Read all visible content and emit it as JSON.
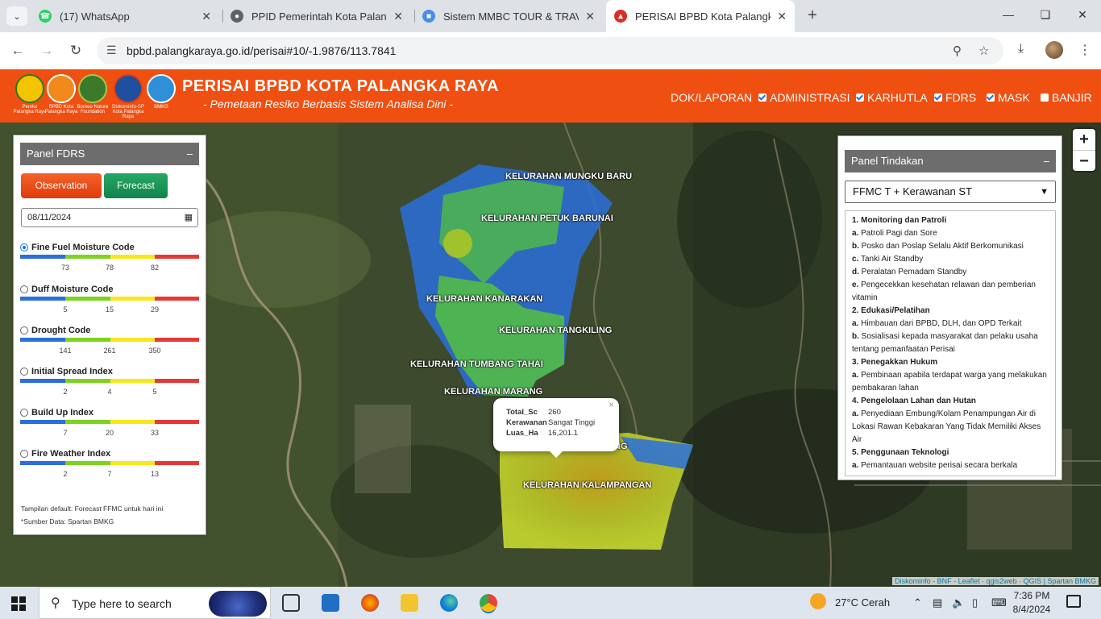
{
  "browser": {
    "tabs": [
      {
        "title": "(17) WhatsApp",
        "icon": "whatsapp-icon",
        "color": "#25d366"
      },
      {
        "title": "PPID Pemerintah Kota Palangka",
        "icon": "globe-icon",
        "color": "#5f6368"
      },
      {
        "title": "Sistem MMBC TOUR & TRAVEL",
        "icon": "site-icon",
        "color": "#4a8fe7"
      },
      {
        "title": "PERISAI BPBD Kota Palangka Ra",
        "icon": "bpbd-icon",
        "color": "#d93025"
      }
    ],
    "url": "bpbd.palangkaraya.go.id/perisai#10/-1.9876/113.7841"
  },
  "header": {
    "title": "PERISAI BPBD KOTA PALANGKA RAYA",
    "subtitle": "- Pemetaan Resiko Berbasis Sistem Analisa Dini -",
    "logos": [
      {
        "caption": "Pemko Palangka Raya",
        "color": "#f5c400"
      },
      {
        "caption": "BPBD Kota Palangka Raya",
        "color": "#f28a1b"
      },
      {
        "caption": "Borneo Nature Foundation",
        "color": "#3a7a2a"
      },
      {
        "caption": "Diskominfo-SP Kota Palangka Raya",
        "color": "#1f4f9e"
      },
      {
        "caption": "BMKG",
        "color": "#2f8fd8"
      }
    ],
    "nav": [
      {
        "label": "DOK/LAPORAN",
        "checkbox": false
      },
      {
        "label": "ADMINISTRASI",
        "checkbox": true,
        "checked": true
      },
      {
        "label": "KARHUTLA",
        "checkbox": true,
        "checked": true
      },
      {
        "label": "FDRS",
        "checkbox": true,
        "checked": true
      },
      {
        "label": "MASK",
        "checkbox": true,
        "checked": true
      },
      {
        "label": "BANJIR",
        "checkbox": true,
        "checked": false
      }
    ]
  },
  "fdrs": {
    "title": "Panel FDRS",
    "minimize": "–",
    "observation": "Observation",
    "forecast": "Forecast",
    "date": "08/11/2024",
    "scale_colors": [
      "#2a6fdb",
      "#7ed321",
      "#f8e71c",
      "#e53935"
    ],
    "codes": [
      {
        "label": "Fine Fuel Moisture Code",
        "selected": true,
        "ticks": [
          "73",
          "78",
          "82"
        ]
      },
      {
        "label": "Duff Moisture Code",
        "selected": false,
        "ticks": [
          "5",
          "15",
          "29"
        ]
      },
      {
        "label": "Drought Code",
        "selected": false,
        "ticks": [
          "141",
          "261",
          "350"
        ]
      },
      {
        "label": "Initial Spread Index",
        "selected": false,
        "ticks": [
          "2",
          "4",
          "5"
        ]
      },
      {
        "label": "Build Up Index",
        "selected": false,
        "ticks": [
          "7",
          "20",
          "33"
        ]
      },
      {
        "label": "Fire Weather Index",
        "selected": false,
        "ticks": [
          "2",
          "7",
          "13"
        ]
      }
    ],
    "note1": "Tampilan default: Forecast FFMC untuk hari ini",
    "note2": "*Sumber Data: Spartan BMKG"
  },
  "map": {
    "labels": [
      "KELURAHAN MUNGKU BARU",
      "KELURAHAN PETUK BARUNAI",
      "KELURAHAN KANARAKAN",
      "KELURAHAN TANGKILING",
      "KELURAHAN TUMBANG TAHAI",
      "KELURAHAN MARANG",
      "NG",
      "KELURAHAN KALAMPANGAN"
    ],
    "popup": {
      "rows": [
        {
          "key": "Total_Sc",
          "value": "260"
        },
        {
          "key": "Kerawanan",
          "value": "Sangat Tinggi"
        },
        {
          "key": "Luas_Ha",
          "value": "16,201.1"
        }
      ],
      "close": "×"
    },
    "zoom_in": "+",
    "zoom_out": "−",
    "attribution": "Diskominfo - BNF - Leaflet · qgis2web · QGIS | Spartan BMKG"
  },
  "tindakan": {
    "title": "Panel Tindakan",
    "minimize": "–",
    "selected": "FFMC T + Kerawanan ST",
    "items": [
      {
        "type": "sec",
        "text": "1. Monitoring dan Patroli"
      },
      {
        "type": "item",
        "key": "a.",
        "text": "Patroli Pagi dan Sore"
      },
      {
        "type": "item",
        "key": "b.",
        "text": "Posko dan Poslap Selalu Aktif Berkomunikasi"
      },
      {
        "type": "item",
        "key": "c.",
        "text": "Tanki Air Standby"
      },
      {
        "type": "item",
        "key": "d.",
        "text": "Peralatan Pemadam Standby"
      },
      {
        "type": "item",
        "key": "e.",
        "text": "Pengecekkan kesehatan relawan dan pemberian vitamin"
      },
      {
        "type": "sec",
        "text": "2. Edukasi/Pelatihan"
      },
      {
        "type": "item",
        "key": "a.",
        "text": "Himbauan dari BPBD, DLH, dan OPD Terkait"
      },
      {
        "type": "item",
        "key": "b.",
        "text": "Sosialisasi kepada masyarakat dan pelaku usaha tentang pemanfaatan Perisai"
      },
      {
        "type": "sec",
        "text": "3. Penegakkan Hukum"
      },
      {
        "type": "item",
        "key": "a.",
        "text": "Pembinaan apabila terdapat warga yang melakukan pembakaran lahan"
      },
      {
        "type": "sec",
        "text": "4. Pengelolaan Lahan dan Hutan"
      },
      {
        "type": "item",
        "key": "a.",
        "text": "Penyediaan Embung/Kolam Penampungan Air di Lokasi Rawan Kebakaran Yang Tidak Memiliki Akses Air"
      },
      {
        "type": "sec",
        "text": "5. Penggunaan Teknologi"
      },
      {
        "type": "item",
        "key": "a.",
        "text": "Pemantauan website perisai secara berkala"
      }
    ]
  },
  "taskbar": {
    "search_placeholder": "Type here to search",
    "weather": "27°C  Cerah",
    "time": "7:36 PM",
    "date": "8/4/2024"
  }
}
